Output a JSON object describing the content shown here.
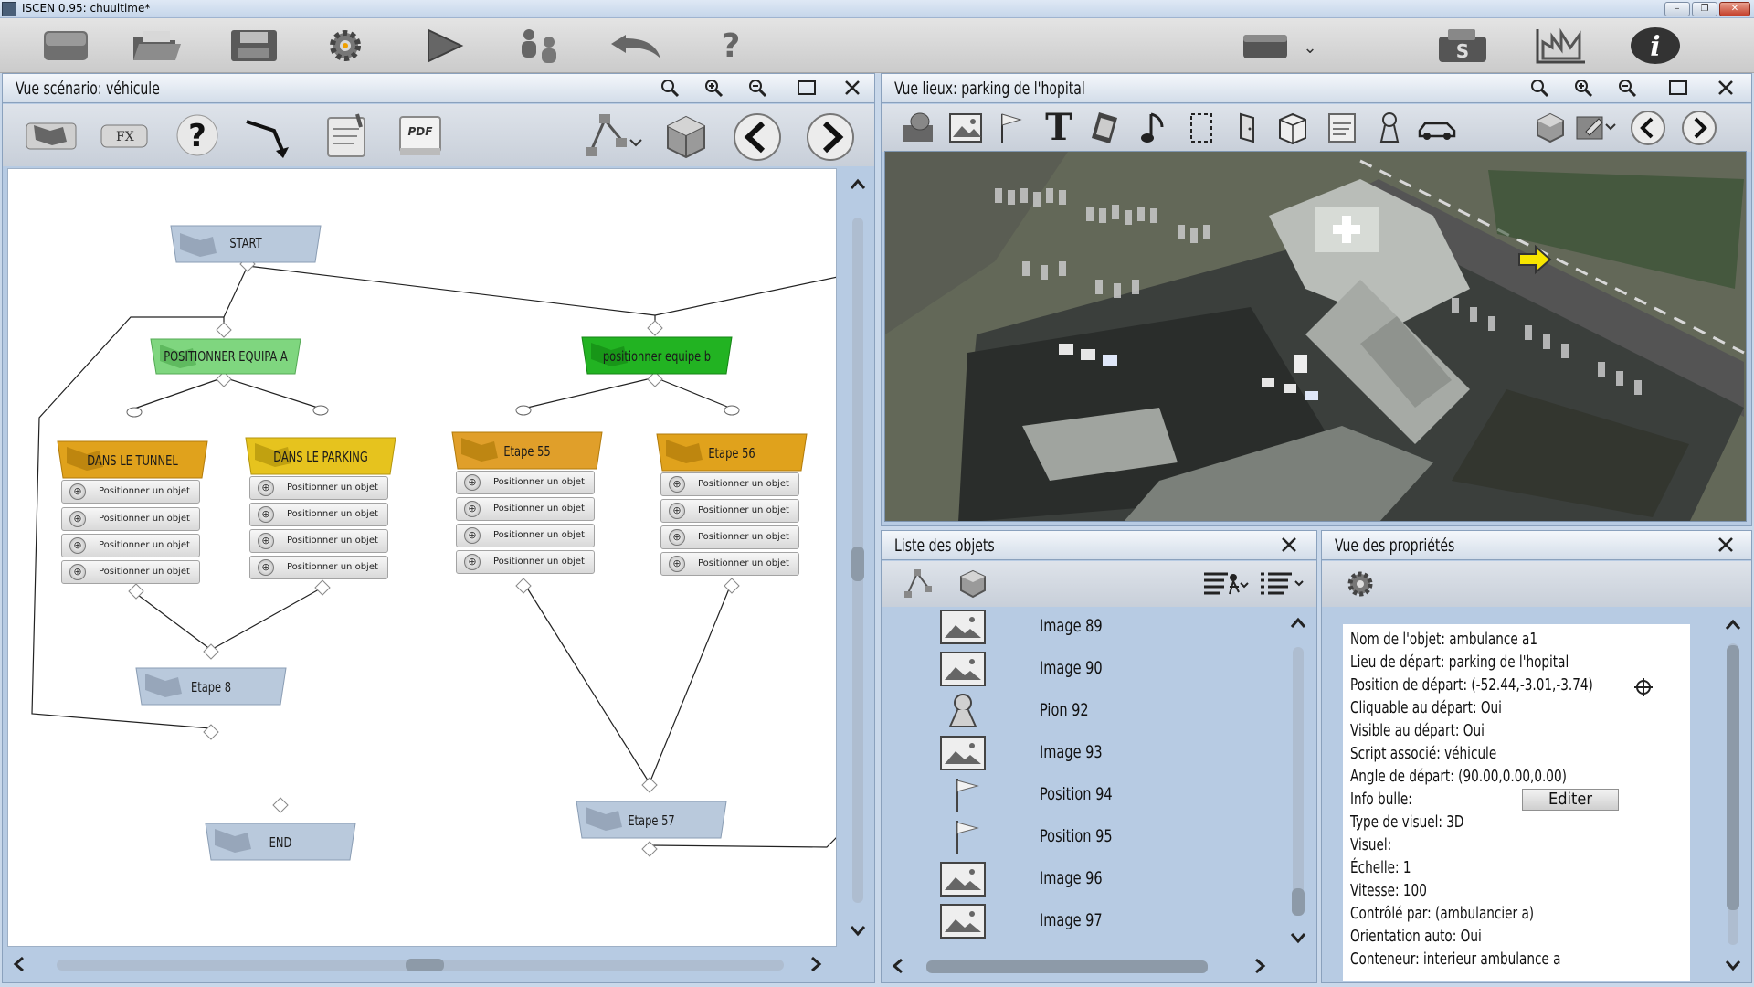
{
  "window": {
    "title": "ISCEN 0.95: chuultime*",
    "minimize_glyph": "–",
    "restore_glyph": "❐",
    "close_glyph": "✕"
  },
  "main_toolbar": {
    "icons": [
      "new-file-icon",
      "open-folder-icon",
      "save-icon",
      "settings-icon",
      "play-icon",
      "users-icon",
      "undo-icon",
      "help-icon",
      "camera-icon",
      "dropdown-icon",
      "scenario-s-icon",
      "chart-icon",
      "info-icon"
    ],
    "help_glyph": "?",
    "info_glyph": "i",
    "s_glyph": "S"
  },
  "scenario_panel": {
    "title": "Vue scénario: véhicule",
    "toolbar_icons": [
      "flag-icon",
      "fx-icon",
      "question-icon",
      "arrow-link-icon",
      "notes-icon",
      "pdf-icon",
      "tree-icon",
      "cube-icon",
      "prev-icon",
      "next-icon"
    ],
    "fx_label": "FX",
    "pdf_label": "PDF",
    "nodes": {
      "start": "START",
      "equipe_a": "POSITIONNER EQUIPA A",
      "equipe_b": "positionner  equipe  b",
      "tunnel": "DANS LE TUNNEL",
      "parking": "DANS LE PARKING",
      "etape55": "Etape 55",
      "etape56": "Etape 56",
      "etape8": "Etape 8",
      "etape57": "Etape 57",
      "end": "END"
    },
    "action_label": "Positionner un objet"
  },
  "places_panel": {
    "title": "Vue lieux: parking de l'hopital",
    "toolbar_icons": [
      "pin-map-icon",
      "image-icon",
      "flag-position-icon",
      "text-icon",
      "film-icon",
      "music-icon",
      "zone-icon",
      "door-icon",
      "box-icon",
      "notes-icon",
      "pawn-icon",
      "car-icon",
      "cube-icon",
      "edit-icon",
      "prev-icon",
      "next-icon"
    ],
    "text_tool_glyph": "T"
  },
  "objects_panel": {
    "title": "Liste des objets",
    "items": [
      {
        "label": "Image 89",
        "icon": "image-icon"
      },
      {
        "label": "Image 90",
        "icon": "image-icon"
      },
      {
        "label": "Pion 92",
        "icon": "pawn-icon"
      },
      {
        "label": "Image 93",
        "icon": "image-icon"
      },
      {
        "label": "Position 94",
        "icon": "flag-icon"
      },
      {
        "label": "Position 95",
        "icon": "flag-icon"
      },
      {
        "label": "Image 96",
        "icon": "image-icon"
      },
      {
        "label": "Image 97",
        "icon": "image-icon"
      }
    ]
  },
  "properties_panel": {
    "title": "Vue des propriétés",
    "lines": [
      "Nom de l'objet: ambulance a1",
      "Lieu de départ: parking de l'hopital",
      "Position de départ: (-52.44,-3.01,-3.74)",
      "Cliquable au départ: Oui",
      "Visible au départ: Oui",
      "Script associé: véhicule",
      "Angle de départ: (90.00,0.00,0.00)",
      "Info bulle:",
      "Type de visuel: 3D",
      "Visuel:",
      "Échelle: 1",
      "Vitesse: 100",
      "Contrôlé par: (ambulancier a)",
      "Orientation auto: Oui",
      "Conteneur: interieur ambulance a"
    ],
    "edit_button": "Editer"
  },
  "colors": {
    "node_blue": "#b9c9dc",
    "node_green": "#7fd67f",
    "node_green_dark": "#22b322",
    "node_orange": "#e0a21c",
    "node_yellow": "#e6c31e",
    "panel_bg": "#b7cbe3"
  }
}
